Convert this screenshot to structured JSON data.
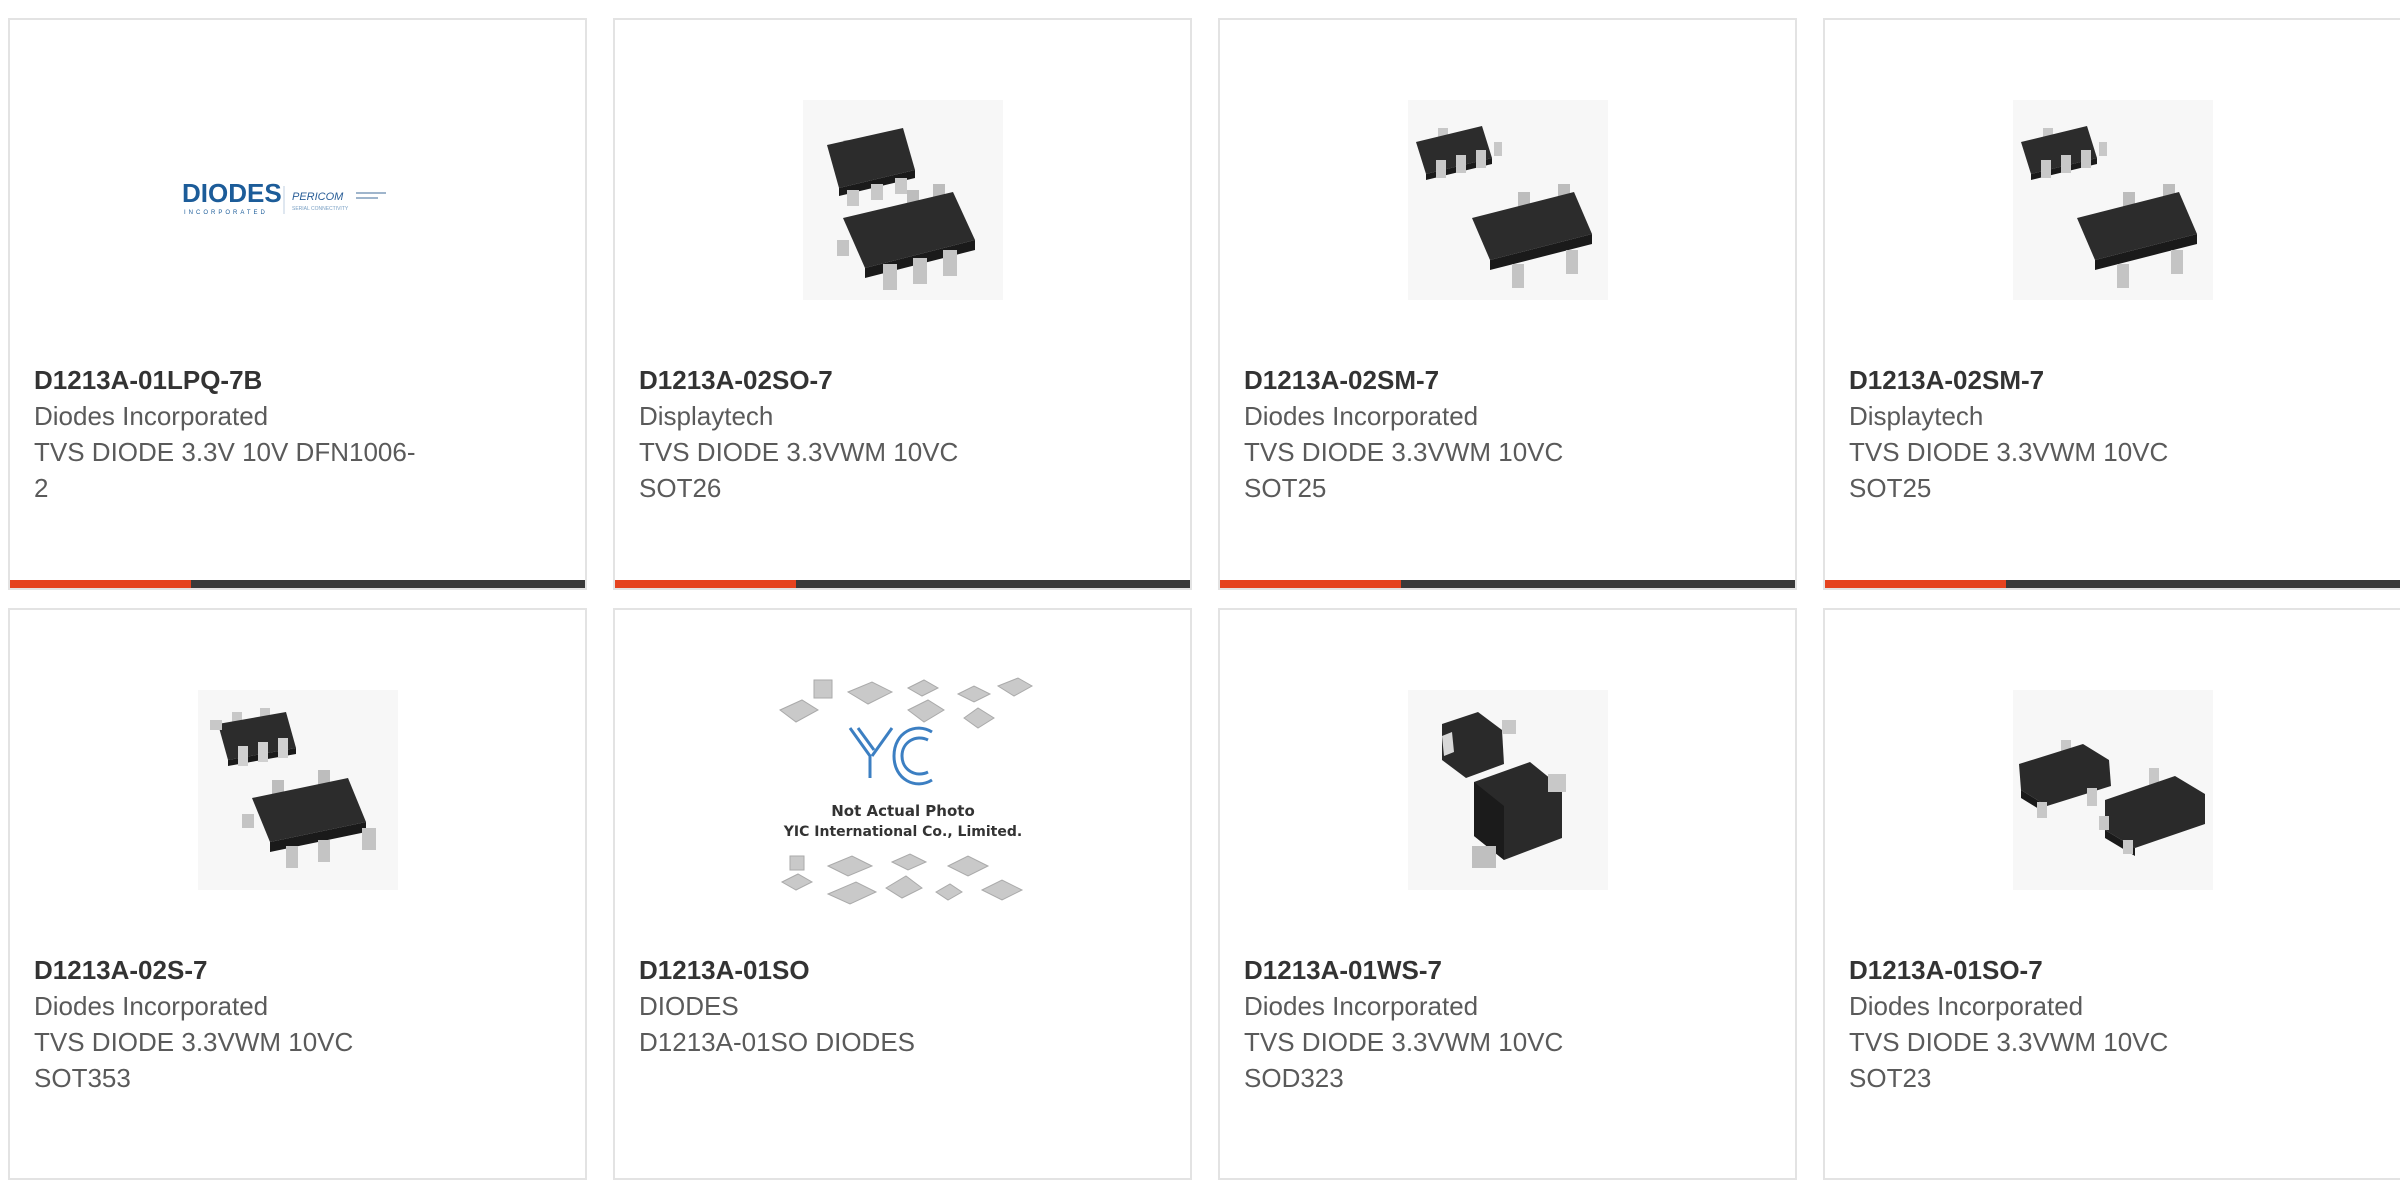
{
  "colors": {
    "accent": "#e5431f",
    "bar": "#3a3a3a",
    "border": "#e3e3e3",
    "part_number_text": "#333333",
    "body_text": "#5a5a5a"
  },
  "products": [
    {
      "image": "diodes-pericom-logo",
      "part_number": "D1213A-01LPQ-7B",
      "manufacturer": "Diodes Incorporated",
      "description_line1": "TVS DIODE 3.3V 10V DFN1006-",
      "description_line2": "2",
      "logo_brand": "DIODES",
      "logo_sub": "INCORPORATED",
      "logo_brand2": "PERICOM",
      "logo_tagline": "SERIAL CONNECTIVITY"
    },
    {
      "image": "sot26-package-icon",
      "part_number": "D1213A-02SO-7",
      "manufacturer": "Displaytech",
      "description_line1": "TVS DIODE 3.3VWM 10VC",
      "description_line2": "SOT26"
    },
    {
      "image": "sot25-package-icon",
      "part_number": "D1213A-02SM-7",
      "manufacturer": "Diodes Incorporated",
      "description_line1": "TVS DIODE 3.3VWM 10VC",
      "description_line2": "SOT25"
    },
    {
      "image": "sot25-package-icon",
      "part_number": "D1213A-02SM-7",
      "manufacturer": "Displaytech",
      "description_line1": "TVS DIODE 3.3VWM 10VC",
      "description_line2": "SOT25"
    },
    {
      "image": "sot353-package-icon",
      "part_number": "D1213A-02S-7",
      "manufacturer": "Diodes Incorporated",
      "description_line1": "TVS DIODE 3.3VWM 10VC",
      "description_line2": "SOT353"
    },
    {
      "image": "yic-placeholder-image",
      "part_number": "D1213A-01SO",
      "manufacturer": "DIODES",
      "description_line1": "D1213A-01SO DIODES",
      "description_line2": "",
      "placeholder_line1": "Not Actual Photo",
      "placeholder_line2": "YIC International Co., Limited."
    },
    {
      "image": "sod323-package-icon",
      "part_number": "D1213A-01WS-7",
      "manufacturer": "Diodes Incorporated",
      "description_line1": "TVS DIODE 3.3VWM 10VC",
      "description_line2": "SOD323"
    },
    {
      "image": "sot23-package-icon",
      "part_number": "D1213A-01SO-7",
      "manufacturer": "Diodes Incorporated",
      "description_line1": "TVS DIODE 3.3VWM 10VC",
      "description_line2": "SOT23"
    }
  ]
}
